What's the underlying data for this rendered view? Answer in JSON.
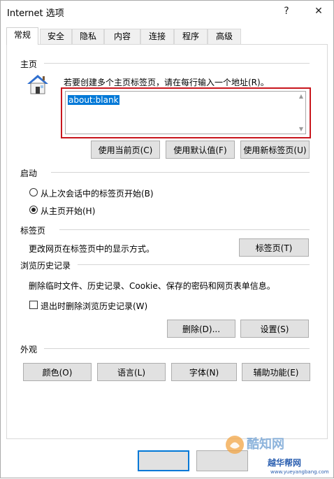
{
  "window": {
    "title": "Internet 选项",
    "help_glyph": "?",
    "close_glyph": "✕"
  },
  "tabs": [
    {
      "label": "常规",
      "active": true
    },
    {
      "label": "安全"
    },
    {
      "label": "隐私"
    },
    {
      "label": "内容"
    },
    {
      "label": "连接"
    },
    {
      "label": "程序"
    },
    {
      "label": "高级"
    }
  ],
  "homepage": {
    "section_title": "主页",
    "instruction": "若要创建多个主页标签页，请在每行输入一个地址(R)。",
    "address_value": "about:blank",
    "use_current": "使用当前页(C)",
    "use_default": "使用默认值(F)",
    "use_new_tab": "使用新标签页(U)"
  },
  "startup": {
    "section_title": "启动",
    "option_last_session": "从上次会话中的标签页开始(B)",
    "option_homepage": "从主页开始(H)",
    "selected": "option_homepage"
  },
  "tabs_section": {
    "section_title": "标签页",
    "description": "更改网页在标签页中的显示方式。",
    "button": "标签页(T)"
  },
  "history": {
    "section_title": "浏览历史记录",
    "description": "删除临时文件、历史记录、Cookie、保存的密码和网页表单信息。",
    "delete_on_exit": "退出时删除浏览历史记录(W)",
    "delete_on_exit_checked": false,
    "delete_button": "删除(D)...",
    "settings_button": "设置(S)"
  },
  "appearance": {
    "section_title": "外观",
    "colors": "颜色(O)",
    "languages": "语言(L)",
    "fonts": "字体(N)",
    "accessibility": "辅助功能(E)"
  },
  "watermark": {
    "brand": "酷知网",
    "brand2": "越华帮网",
    "url": "www.yueyangbang.com"
  },
  "colors": {
    "highlight": "#0078d7",
    "red_frame": "#c8161d",
    "button_face": "#e1e1e1"
  }
}
